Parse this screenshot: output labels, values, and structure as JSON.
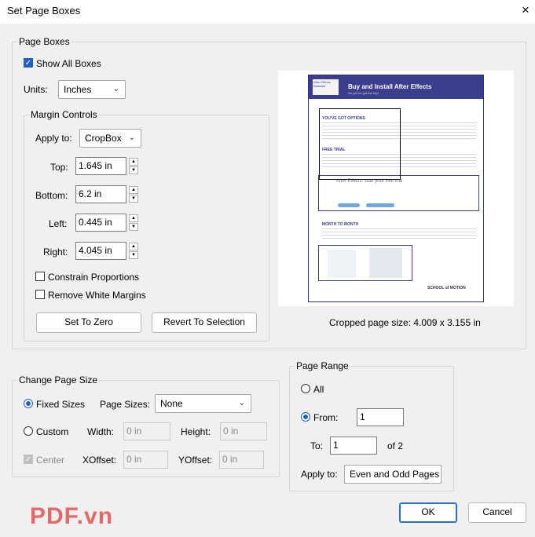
{
  "window": {
    "title": "Set Page Boxes",
    "close_icon": "×"
  },
  "page_boxes": {
    "legend": "Page Boxes",
    "show_all_boxes": {
      "label": "Show All Boxes",
      "checked": true
    },
    "units": {
      "label": "Units:",
      "value": "Inches"
    },
    "margin_controls": {
      "legend": "Margin Controls",
      "apply_to": {
        "label": "Apply to:",
        "value": "CropBox"
      },
      "top": {
        "label": "Top:",
        "value": "1.645 in"
      },
      "bottom": {
        "label": "Bottom:",
        "value": "6.2 in"
      },
      "left": {
        "label": "Left:",
        "value": "0.445 in"
      },
      "right": {
        "label": "Right:",
        "value": "4.045 in"
      },
      "constrain_proportions": {
        "label": "Constrain Proportions",
        "checked": false
      },
      "remove_white_margins": {
        "label": "Remove White Margins",
        "checked": false
      },
      "set_to_zero": "Set To Zero",
      "revert_to_selection": "Revert To Selection"
    },
    "cropped_size": "Cropped page size: 4.009 x 3.155 in"
  },
  "preview_page": {
    "logo_text": "After Effects Kickstart",
    "title": "Buy and Install After Effects",
    "subtitle": "So you've got the key!",
    "heading1": "YOU'VE GOT OPTIONS",
    "heading2": "FREE TRIAL",
    "trial_box": "After Effects: start your free trial",
    "heading3": "MONTH TO MONTH",
    "footer_brand": "SCHOOL of MOTION"
  },
  "change_page_size": {
    "legend": "Change Page Size",
    "fixed_sizes": {
      "label": "Fixed Sizes",
      "selected": true
    },
    "page_sizes": {
      "label": "Page Sizes:",
      "value": "None"
    },
    "custom": {
      "label": "Custom",
      "selected": false
    },
    "width": {
      "label": "Width:",
      "value": "0 in"
    },
    "height": {
      "label": "Height:",
      "value": "0 in"
    },
    "center": {
      "label": "Center",
      "checked": true,
      "disabled": true
    },
    "xoffset": {
      "label": "XOffset:",
      "value": "0 in"
    },
    "yoffset": {
      "label": "YOffset:",
      "value": "0 in"
    }
  },
  "page_range": {
    "legend": "Page Range",
    "all": {
      "label": "All",
      "selected": false
    },
    "from": {
      "label": "From:",
      "value": "1",
      "selected": true
    },
    "to": {
      "label": "To:",
      "value": "1"
    },
    "of_total": "of 2",
    "apply_to": {
      "label": "Apply to:",
      "value": "Even and Odd Pages"
    }
  },
  "buttons": {
    "ok": "OK",
    "cancel": "Cancel"
  },
  "watermark": "PDF.vn",
  "colors": {
    "accent": "#1f5fbf",
    "page_brand": "#3b3d8f",
    "watermark": "#e26a6a"
  }
}
